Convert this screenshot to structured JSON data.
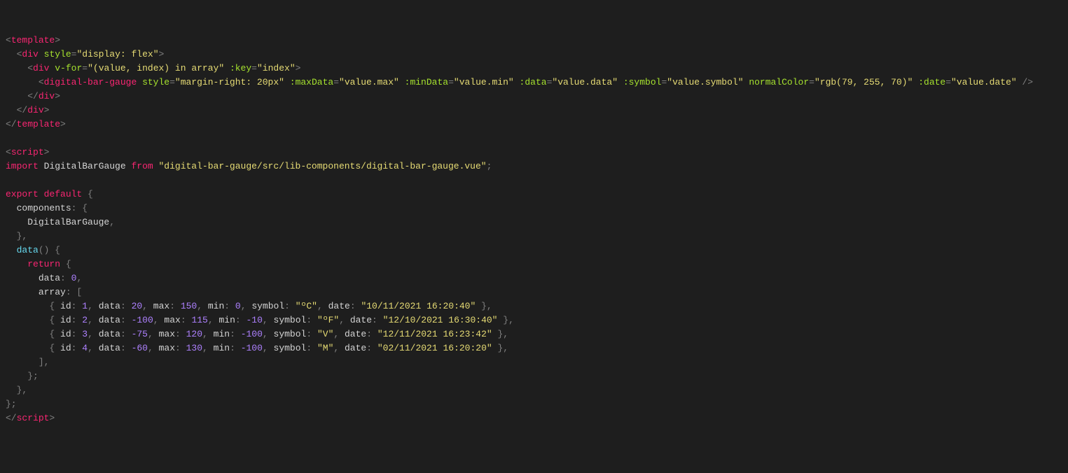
{
  "code": {
    "template": {
      "open": "template",
      "divOuterStyle": "display: flex",
      "vfor": "(value, index) in array",
      "keyAttr": ":key",
      "keyVal": "index",
      "component": "digital-bar-gauge",
      "compStyle": "margin-right: 20px",
      "maxDataAttr": ":maxData",
      "maxDataVal": "value.max",
      "minDataAttr": ":minData",
      "minDataVal": "value.min",
      "dataAttr": ":data",
      "dataVal": "value.data",
      "symbolAttr": ":symbol",
      "symbolVal": "value.symbol",
      "normalColorAttr": "normalColor",
      "normalColorVal": "rgb(79, 255, 70)",
      "dateAttr": ":date",
      "dateVal": "value.date",
      "div": "div"
    },
    "script": {
      "tag": "script",
      "importKw": "import",
      "importName": "DigitalBarGauge",
      "fromKw": "from",
      "importPath": "\"digital-bar-gauge/src/lib-components/digital-bar-gauge.vue\"",
      "exportKw": "export",
      "defaultKw": "default",
      "componentsKey": "components",
      "componentsVal": "DigitalBarGauge",
      "dataFn": "data",
      "returnKw": "return",
      "dataKey": "data",
      "dataZero": "0",
      "arrayKey": "array",
      "rows": [
        {
          "id": "1",
          "data": "20",
          "max": "150",
          "min": "0",
          "symbol": "\"ºC\"",
          "date": "\"10/11/2021 16:20:40\""
        },
        {
          "id": "2",
          "data": "-100",
          "max": "115",
          "min": "-10",
          "symbol": "\"ºF\"",
          "date": "\"12/10/2021 16:30:40\""
        },
        {
          "id": "3",
          "data": "-75",
          "max": "120",
          "min": "-100",
          "symbol": "\"V\"",
          "date": "\"12/11/2021 16:23:42\""
        },
        {
          "id": "4",
          "data": "-60",
          "max": "130",
          "min": "-100",
          "symbol": "\"M\"",
          "date": "\"02/11/2021 16:20:20\""
        }
      ],
      "idKey": "id",
      "dataKey2": "data",
      "maxKey": "max",
      "minKey": "min",
      "symbolKey": "symbol",
      "dateKey": "date"
    }
  }
}
